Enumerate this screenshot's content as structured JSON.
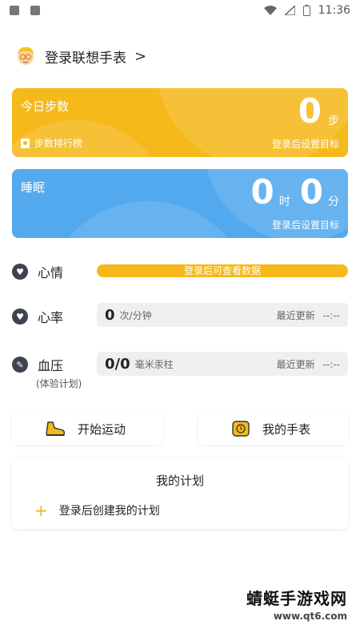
{
  "status_bar": {
    "time": "11:36"
  },
  "header": {
    "title": "登录联想手表",
    "chevron": ">"
  },
  "steps_card": {
    "title": "今日步数",
    "value": "0",
    "unit": "步",
    "ranking": "步数排行榜",
    "subtitle": "登录后设置目标",
    "color": "#f6b91c"
  },
  "sleep_card": {
    "title": "睡眠",
    "hours": "0",
    "hours_unit": "时",
    "minutes": "0",
    "minutes_unit": "分",
    "subtitle": "登录后设置目标",
    "color": "#53a9ee"
  },
  "mood": {
    "label": "心情",
    "notice": "登录后可查看数据"
  },
  "heart_rate": {
    "label": "心率",
    "value": "0",
    "unit": "次/分钟",
    "recent_label": "最近更新",
    "recent_value": "--:--"
  },
  "blood_pressure": {
    "label": "血压",
    "note": "(体验计划)",
    "value": "0/0",
    "unit": "毫米汞柱",
    "recent_label": "最近更新",
    "recent_value": "--:--"
  },
  "actions": {
    "start_exercise": "开始运动",
    "my_watch": "我的手表"
  },
  "plan": {
    "title": "我的计划",
    "add_label": "登录后创建我的计划"
  },
  "watermark": {
    "line1": "蜻蜓手游戏网",
    "line2": "www.qt6.com"
  }
}
